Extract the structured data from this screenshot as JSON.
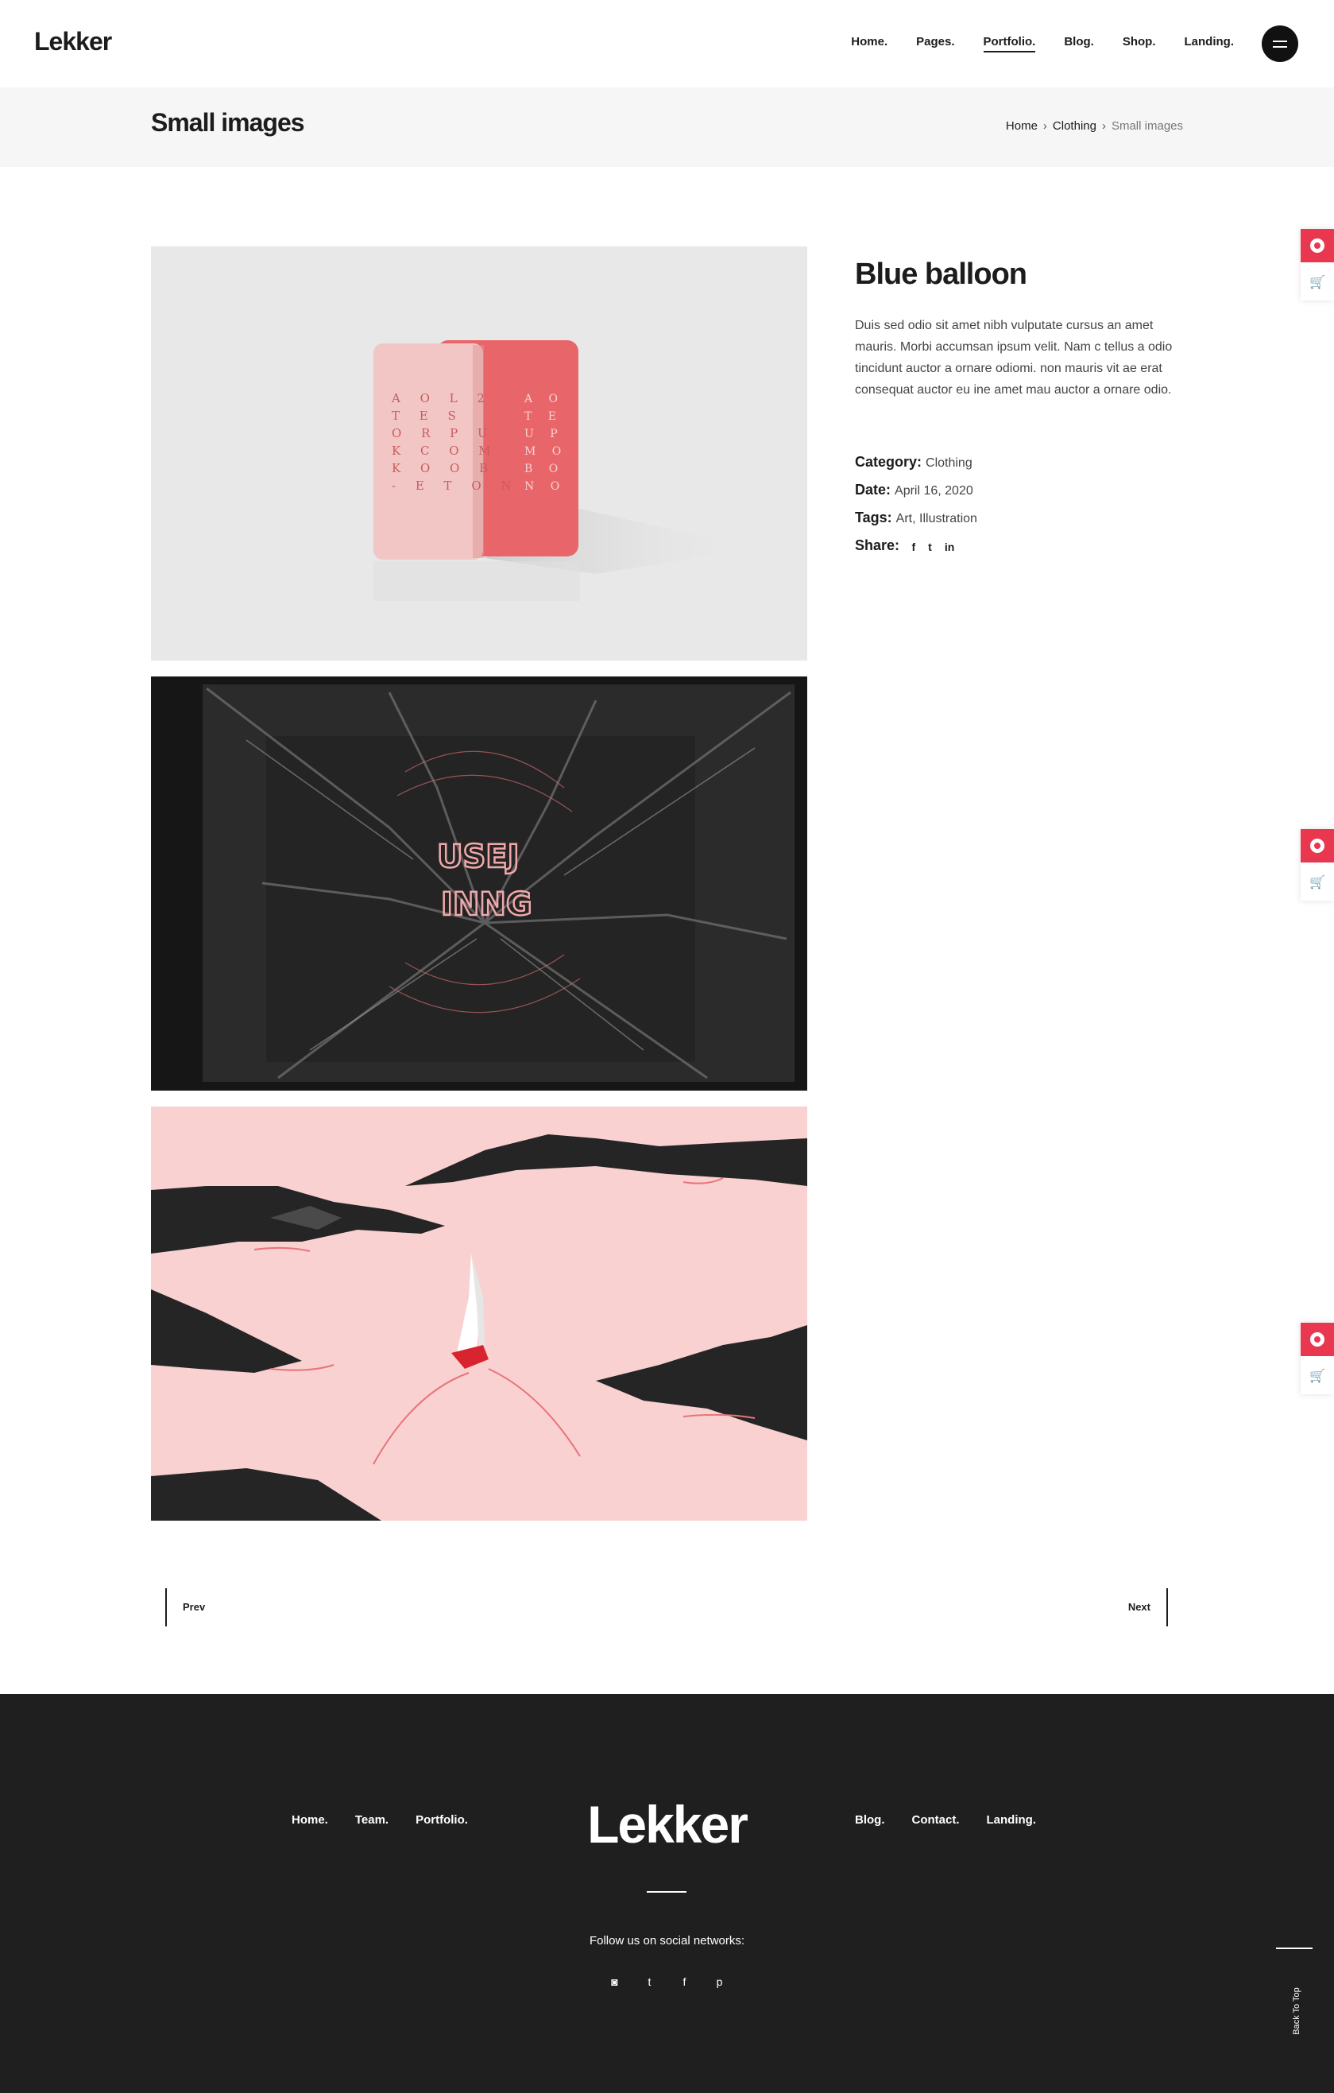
{
  "header": {
    "logo": "Lekker",
    "nav": [
      "Home.",
      "Pages.",
      "Portfolio.",
      "Blog.",
      "Shop.",
      "Landing."
    ],
    "active_nav": "Portfolio."
  },
  "title_bar": {
    "title": "Small images",
    "breadcrumb": [
      "Home",
      "Clothing",
      "Small images"
    ]
  },
  "product": {
    "title": "Blue balloon",
    "description": "Duis sed odio sit amet nibh vulputate cursus an amet mauris. Morbi accumsan ipsum velit. Nam c tellus a odio tincidunt auctor a ornare odiomi. non mauris vit ae erat consequat auctor eu ine amet mau auctor a ornare odio.",
    "category_label": "Category:",
    "category": "Clothing",
    "date_label": "Date:",
    "date": "April 16, 2020",
    "tags_label": "Tags:",
    "tags": "Art, Illustration",
    "share_label": "Share:",
    "share_icons": [
      "facebook-icon",
      "twitter-icon",
      "linkedin-icon"
    ]
  },
  "pager": {
    "prev": "Prev",
    "next": "Next"
  },
  "footer": {
    "nav_left": [
      "Home.",
      "Team.",
      "Portfolio."
    ],
    "logo": "Lekker",
    "nav_right": [
      "Blog.",
      "Contact.",
      "Landing."
    ],
    "follow_text": "Follow us on social networks:",
    "social_icons": [
      "instagram-icon",
      "twitter-icon",
      "facebook-icon",
      "pinterest-icon"
    ],
    "back_to_top": "Back To Top"
  },
  "colors": {
    "accent": "#e8374f",
    "footer_bg": "#1f1f1f",
    "title_bar_bg": "#f6f6f6"
  }
}
